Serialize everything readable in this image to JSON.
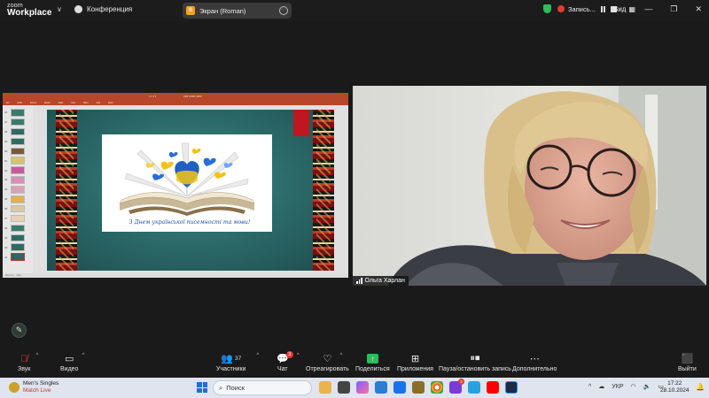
{
  "topbar": {
    "logo_line1": "zoom",
    "logo_line2": "Workplace",
    "conference_label": "Конференция",
    "screen_share_label": "Экран (Roman)",
    "recording_label": "Запись...",
    "view_label": "Вид"
  },
  "slide": {
    "caption": "З Днем української писемності та мови!"
  },
  "thumbnails": [
    "26",
    "27",
    "28",
    "29",
    "30",
    "31",
    "32",
    "33",
    "34",
    "35",
    "36",
    "37",
    "38",
    "39",
    "40",
    "41"
  ],
  "video": {
    "participant_name": "Ольга Харлан"
  },
  "toolbar": {
    "audio_label": "Звук",
    "video_label": "Видео",
    "participants_label": "Участники",
    "participants_count": "37",
    "chat_label": "Чат",
    "chat_badge": "3",
    "react_label": "Отреагировать",
    "share_label": "Поделиться",
    "apps_label": "Приложения",
    "record_label": "Пауза/остановить запись",
    "more_label": "Дополнительно",
    "leave_label": "Выйти"
  },
  "taskbar": {
    "weather_title": "Men's Singles",
    "weather_subtitle": "Match Live",
    "search_placeholder": "Поиск",
    "mail_badge": "3",
    "lang": "УКР",
    "time": "17:22",
    "date": "28.10.2024"
  },
  "colors": {
    "accent_green": "#2dbb5c",
    "record_red": "#e53935",
    "ppt_red": "#b7472a",
    "slide_teal": "#2a6766"
  }
}
